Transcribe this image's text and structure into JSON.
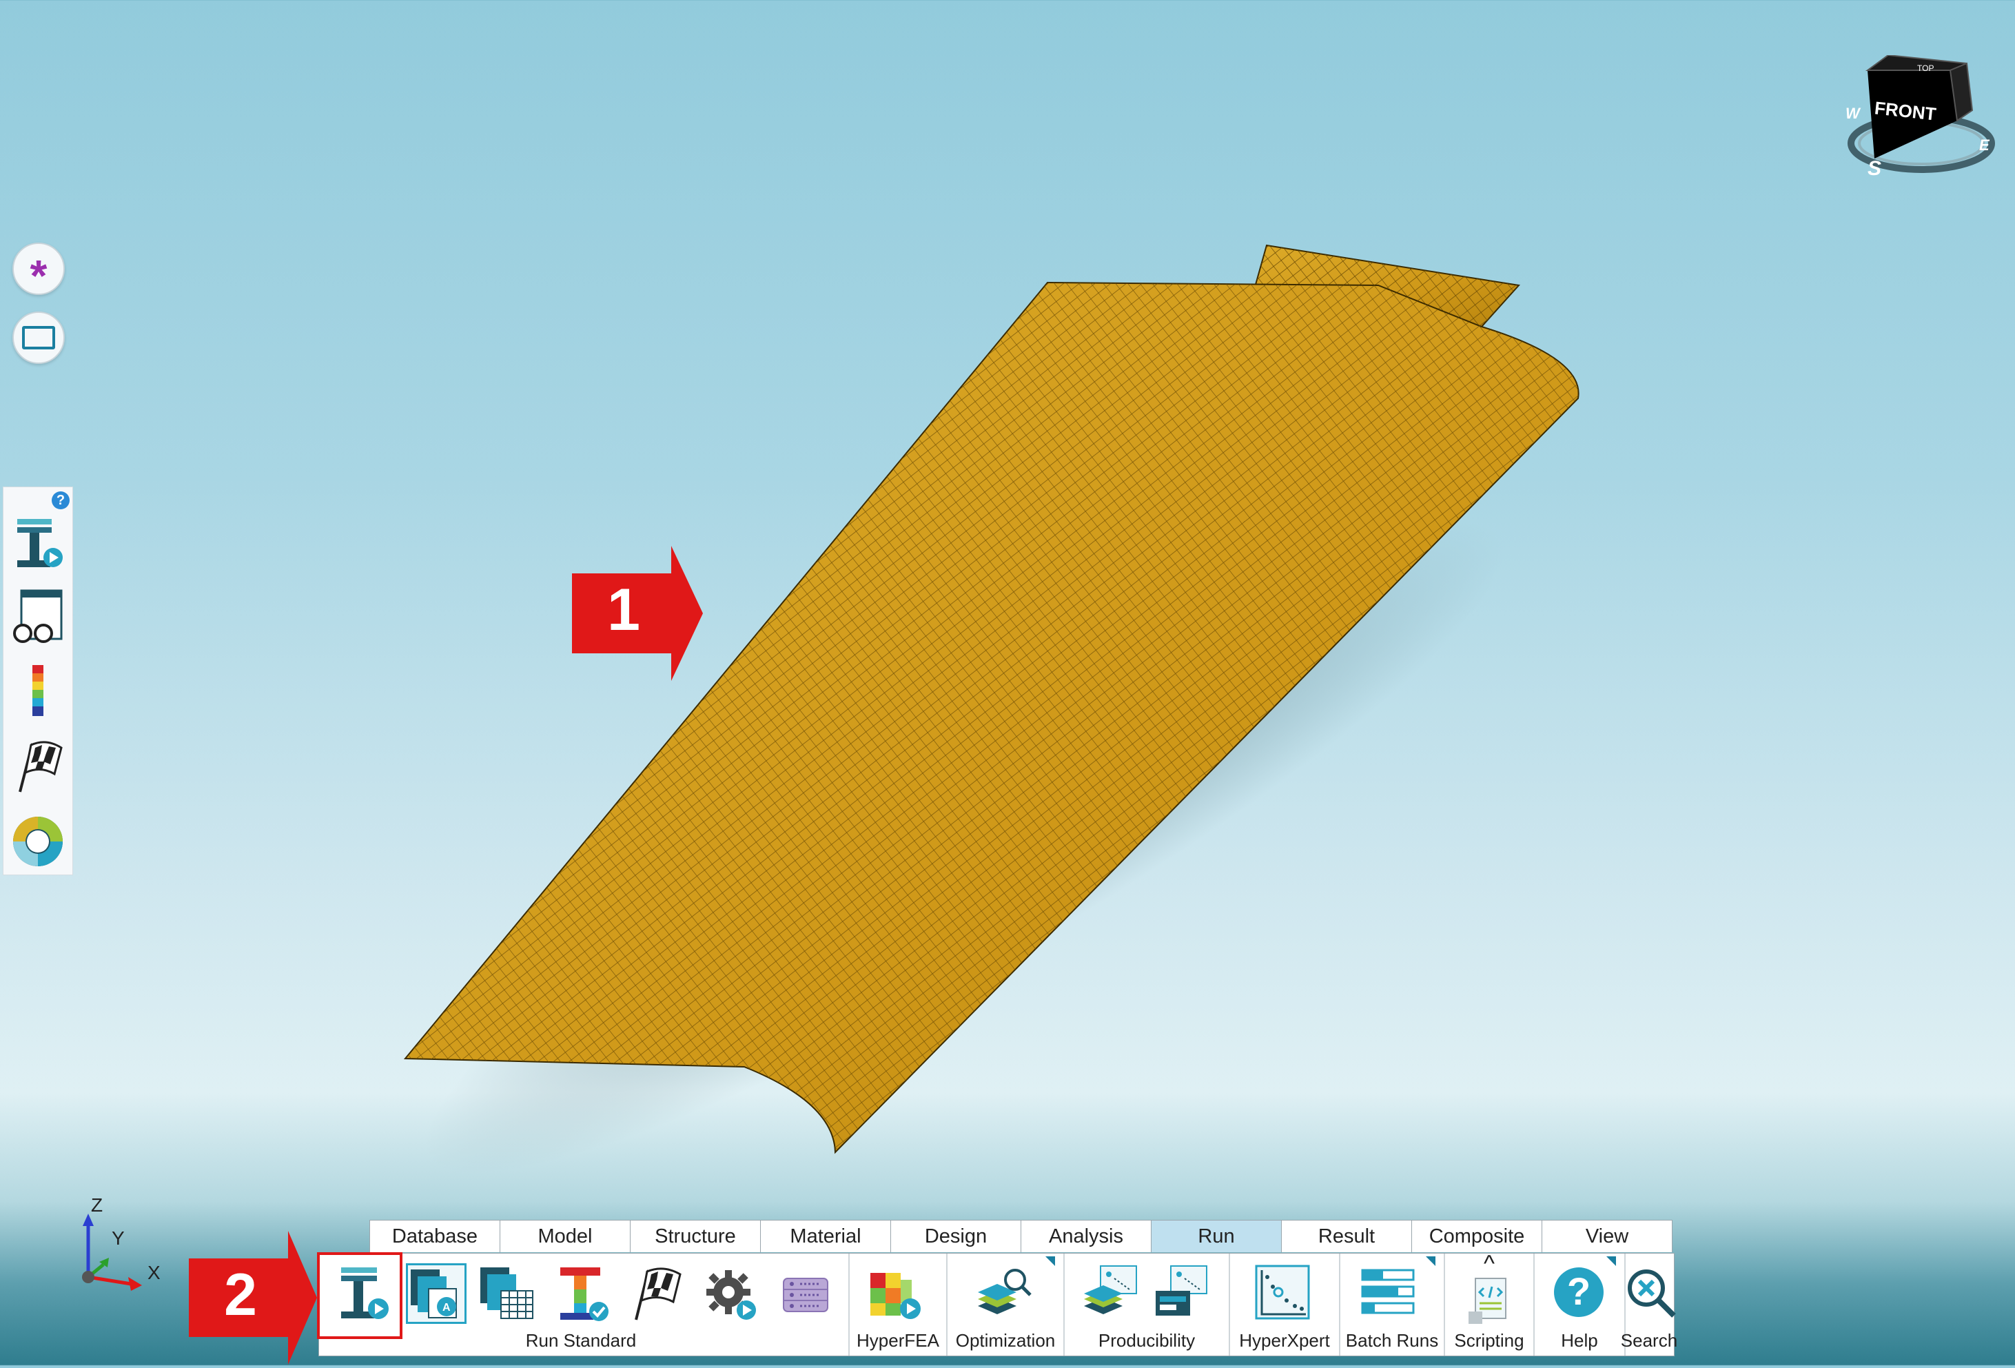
{
  "callouts": {
    "first": "1",
    "second": "2"
  },
  "ribbon": {
    "tabs": [
      {
        "label": "Database",
        "active": false
      },
      {
        "label": "Model",
        "active": false
      },
      {
        "label": "Structure",
        "active": false
      },
      {
        "label": "Material",
        "active": false
      },
      {
        "label": "Design",
        "active": false
      },
      {
        "label": "Analysis",
        "active": false
      },
      {
        "label": "Run",
        "active": true
      },
      {
        "label": "Result",
        "active": false
      },
      {
        "label": "Composite",
        "active": false
      },
      {
        "label": "View",
        "active": false
      }
    ],
    "groups": {
      "run_standard": "Run Standard",
      "hyperfea": "HyperFEA",
      "optimization": "Optimization",
      "producibility": "Producibility",
      "hyperxpert": "HyperXpert",
      "batch_runs": "Batch Runs",
      "scripting": "Scripting",
      "help": "Help",
      "search": "Search"
    },
    "scripting_caret": "^"
  },
  "viewcube": {
    "face": "FRONT",
    "top": "TOP",
    "south": "S",
    "west": "W",
    "east": "E"
  },
  "triad": {
    "z": "Z",
    "y": "Y",
    "x": "X"
  },
  "palette": {
    "help_badge": "?"
  },
  "colors": {
    "panel": "#d9a21c",
    "accent_red": "#e01818",
    "active_tab": "#bfe0ef"
  }
}
